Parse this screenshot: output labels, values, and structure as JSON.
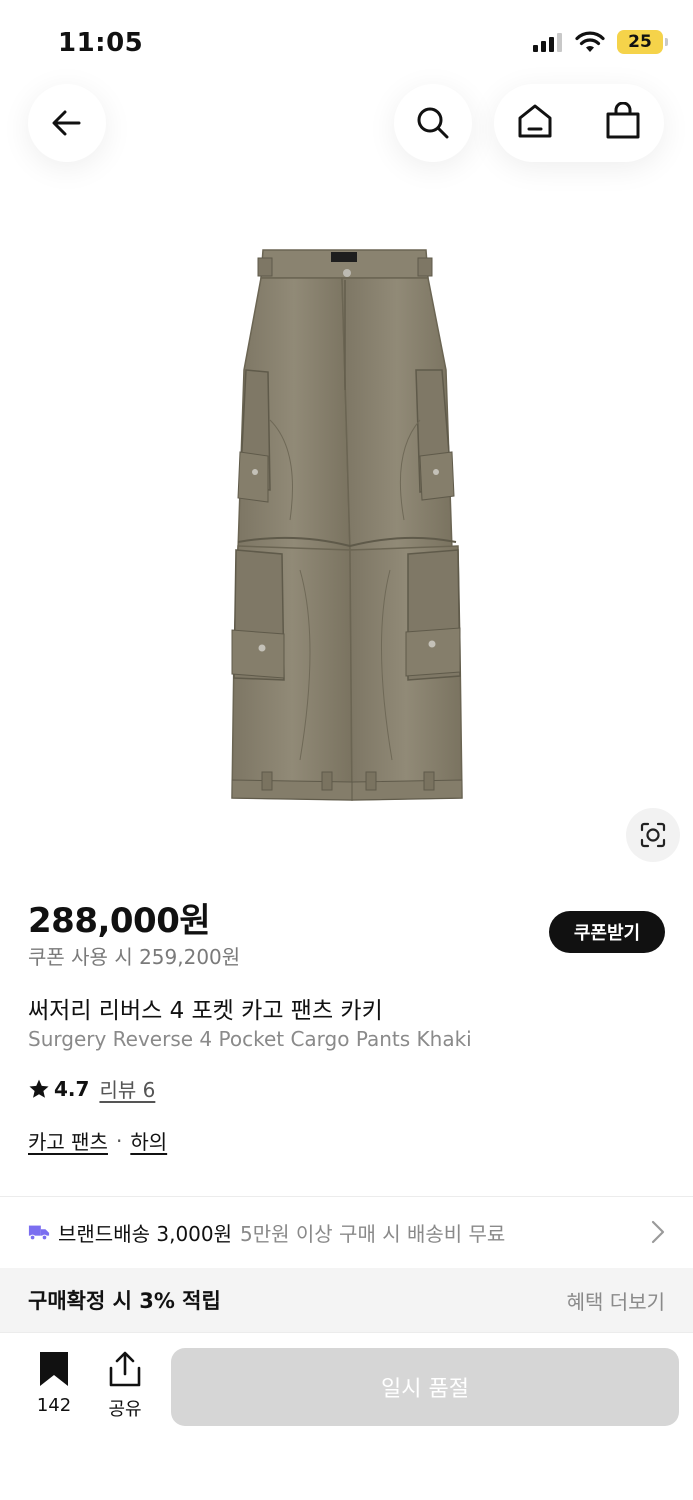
{
  "status_bar": {
    "time": "11:05",
    "battery": "25",
    "icons": [
      "cellular-signal-icon",
      "wifi-icon",
      "battery-icon"
    ]
  },
  "nav": {
    "icons": [
      "back-arrow-icon",
      "search-icon",
      "home-icon",
      "shopping-bag-icon"
    ]
  },
  "product": {
    "image_subject": "khaki cargo pants",
    "price": "288,000원",
    "coupon_price": "쿠폰 사용 시 259,200원",
    "coupon_button": "쿠폰받기",
    "title_ko": "써저리 리버스 4 포켓 카고 팬츠 카키",
    "title_en": "Surgery Reverse 4 Pocket Cargo Pants Khaki",
    "rating": "4.7",
    "review_link": "리뷰 6",
    "categories": [
      "카고 팬츠",
      "하의"
    ],
    "category_separator": "·"
  },
  "shipping": {
    "brand_shipping": "브랜드배송 3,000원",
    "free_condition": "5만원 이상 구매 시 배송비 무료"
  },
  "benefit": {
    "title": "구매확정 시 3% 적립",
    "more_link": "혜택 더보기"
  },
  "bottom_bar": {
    "bookmark_count": "142",
    "share_label": "공유",
    "cta_label": "일시 품절"
  },
  "colors": {
    "accent_truck": "#7b6ef0",
    "sold_out_button": "#d6d6d6",
    "coupon_button": "#111111",
    "battery": "#f5d34a",
    "pants": "#8a8270"
  }
}
